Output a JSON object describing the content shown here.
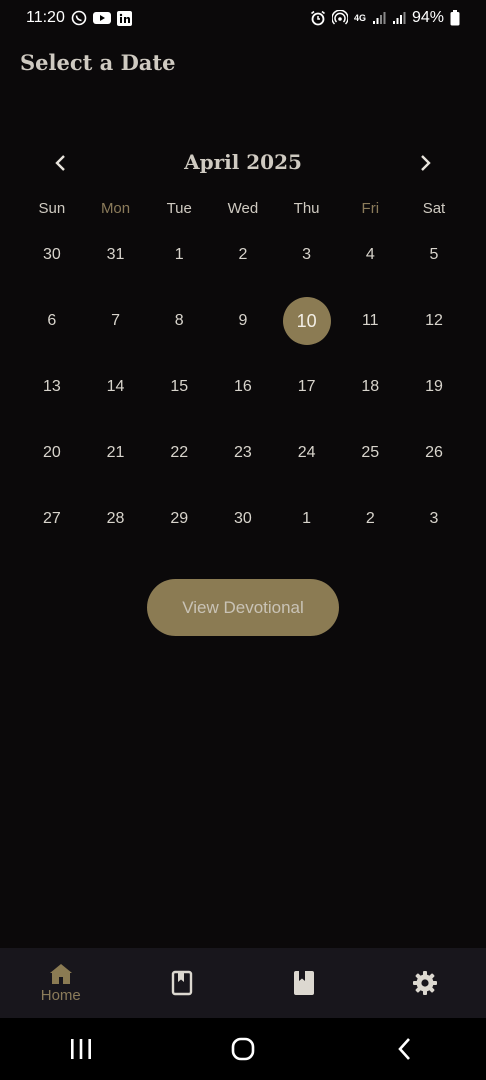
{
  "status_bar": {
    "time": "11:20",
    "battery": "94%",
    "network_label": "4G",
    "left_icons": [
      "whatsapp-icon",
      "youtube-icon",
      "linkedin-icon"
    ],
    "right_icons": [
      "alarm-icon",
      "hotspot-icon",
      "signal-icon",
      "signal-icon",
      "battery-icon"
    ]
  },
  "page": {
    "title": "Select a Date"
  },
  "calendar": {
    "month_label": "April 2025",
    "weekdays": [
      "Sun",
      "Mon",
      "Tue",
      "Wed",
      "Thu",
      "Fri",
      "Sat"
    ],
    "weeks": [
      [
        "30",
        "31",
        "1",
        "2",
        "3",
        "4",
        "5"
      ],
      [
        "6",
        "7",
        "8",
        "9",
        "10",
        "11",
        "12"
      ],
      [
        "13",
        "14",
        "15",
        "16",
        "17",
        "18",
        "19"
      ],
      [
        "20",
        "21",
        "22",
        "23",
        "24",
        "25",
        "26"
      ],
      [
        "27",
        "28",
        "29",
        "30",
        "1",
        "2",
        "3"
      ]
    ],
    "selected_day": "10"
  },
  "action": {
    "view_label": "View Devotional"
  },
  "bottom_nav": {
    "items": [
      {
        "icon": "home-icon",
        "label": "Home",
        "active": true
      },
      {
        "icon": "bookmark-book-icon",
        "label": "",
        "active": false
      },
      {
        "icon": "book-icon",
        "label": "",
        "active": false
      },
      {
        "icon": "gear-icon",
        "label": "",
        "active": false
      }
    ]
  },
  "colors": {
    "accent": "#8b7b53",
    "background": "#0b090a",
    "nav_background": "#18161c",
    "text": "#d8d4cc"
  }
}
